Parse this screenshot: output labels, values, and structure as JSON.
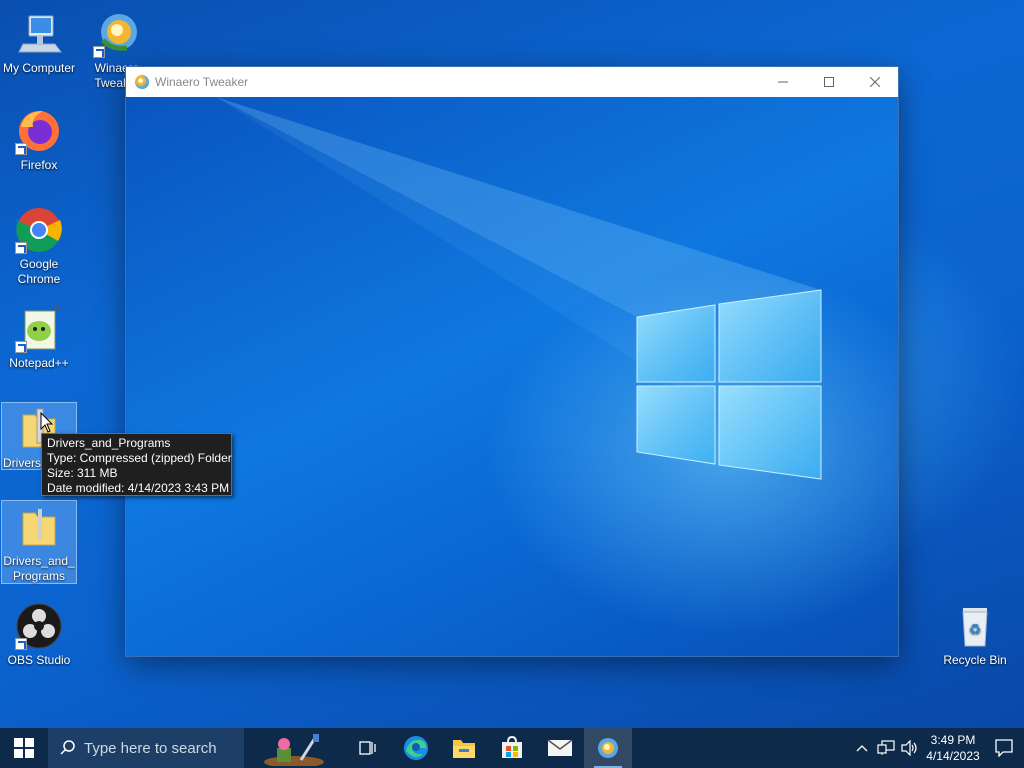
{
  "desktop": {
    "icons": [
      {
        "label": "My Computer"
      },
      {
        "label": "Winaero Tweaker"
      },
      {
        "label": "Firefox"
      },
      {
        "label": "Google Chrome"
      },
      {
        "label": "Notepad++"
      },
      {
        "label": "Drivers_"
      },
      {
        "label": "Drivers_and_Programs"
      },
      {
        "label": "OBS Studio"
      },
      {
        "label": "Recycle Bin"
      }
    ]
  },
  "window": {
    "title": "Winaero Tweaker",
    "minimize_symbol": "—",
    "maximize_symbol": "☐",
    "close_symbol": "✕"
  },
  "tooltip": {
    "name": "Drivers_and_Programs",
    "type": "Type: Compressed (zipped) Folder",
    "size": "Size: 311 MB",
    "modified": "Date modified: 4/14/2023 3:43 PM"
  },
  "taskbar": {
    "search_placeholder": "Type here to search",
    "apps": [
      {
        "icon": "task-view-icon"
      },
      {
        "icon": "edge-icon"
      },
      {
        "icon": "file-explorer-icon"
      },
      {
        "icon": "microsoft-store-icon"
      },
      {
        "icon": "mail-icon"
      },
      {
        "icon": "winaero-tweaker-icon"
      }
    ],
    "clock": {
      "time": "3:49 PM",
      "date": "4/14/2023"
    }
  },
  "colors": {
    "taskbar": "#0e2a4a",
    "wallpaper_blue": "#0c68d4",
    "tooltip_bg": "#1f1f1f"
  }
}
